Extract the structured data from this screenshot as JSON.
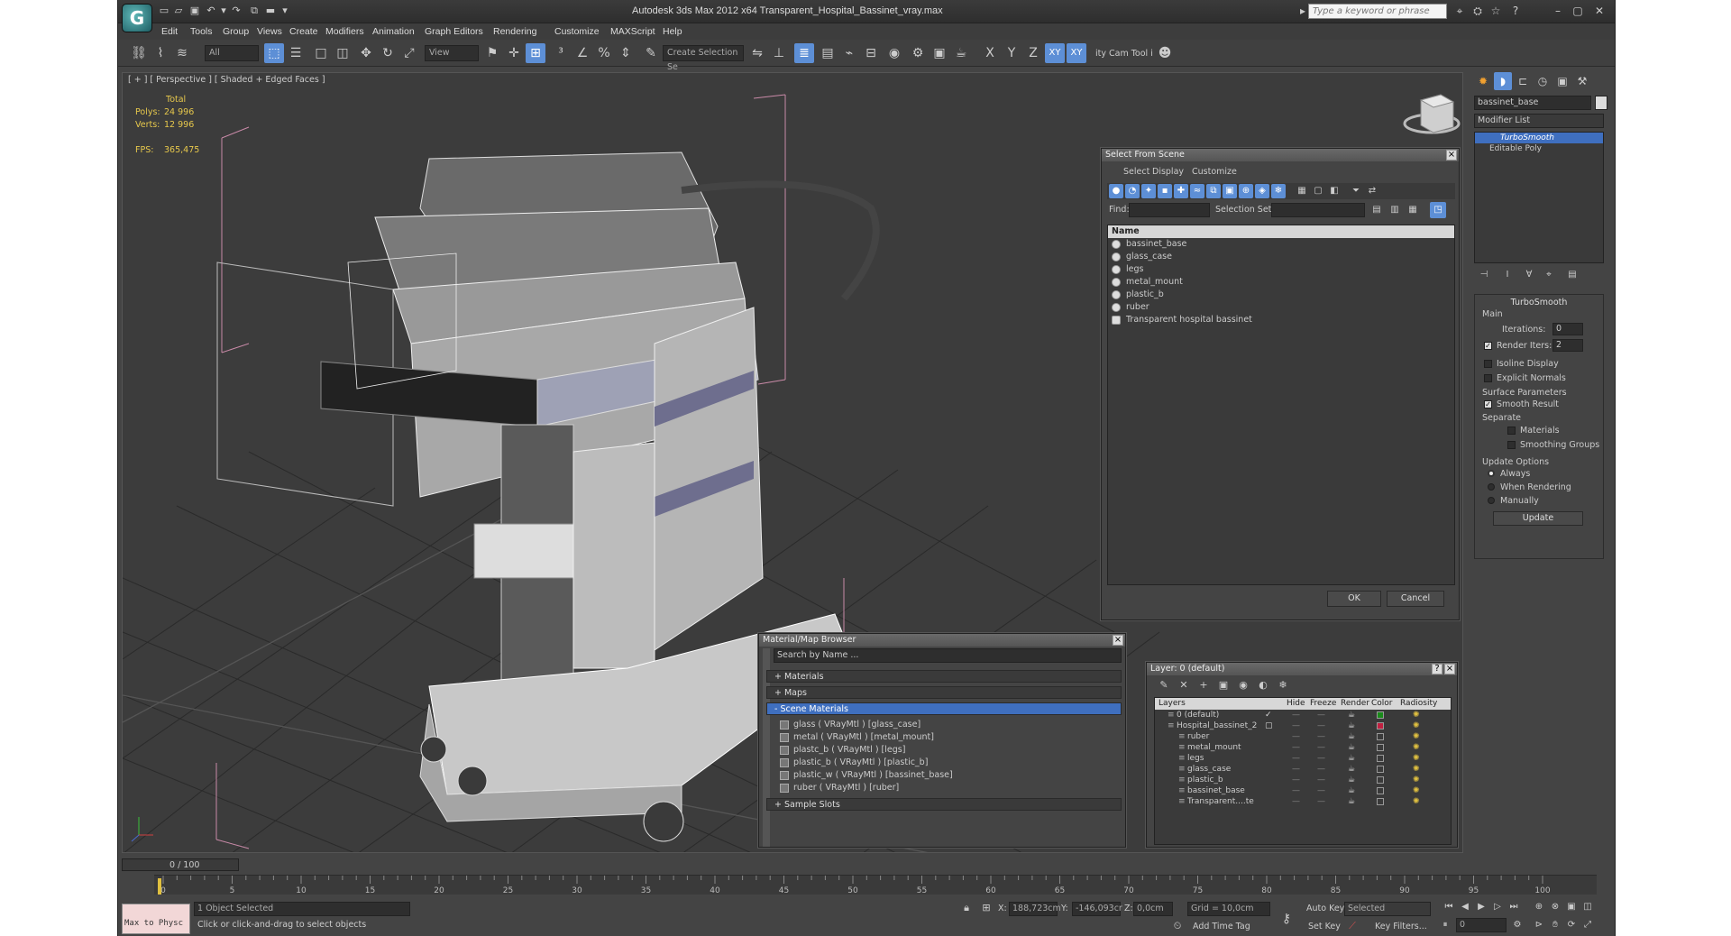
{
  "app": {
    "title": "Autodesk 3ds Max  2012 x64     Transparent_Hospital_Bassinet_vray.max",
    "search_placeholder": "Type a keyword or phrase",
    "logo_letter": "G"
  },
  "menu": [
    "Edit",
    "Tools",
    "Group",
    "Views",
    "Create",
    "Modifiers",
    "Animation",
    "Graph Editors",
    "Rendering",
    "Customize",
    "MAXScript",
    "Help"
  ],
  "toolbar": {
    "filter": "All",
    "ref_coord": "View",
    "selection_set": "Create Selection Se",
    "axes": [
      "X",
      "Y",
      "Z",
      "XY",
      "XY"
    ],
    "cam_tool": "ity Cam Tool i"
  },
  "viewport": {
    "label": "[ + ] [ Perspective ] [ Shaded + Edged Faces ]",
    "stats_total": "Total",
    "polys_label": "Polys:",
    "polys_value": "24 996",
    "verts_label": "Verts:",
    "verts_value": "12 996",
    "fps_label": "FPS:",
    "fps_value": "365,475"
  },
  "command_panel": {
    "object_name": "bassinet_base",
    "modifier_list": "Modifier List",
    "stack": [
      "TurboSmooth",
      "Editable Poly"
    ],
    "turbosmooth": {
      "title": "TurboSmooth",
      "main_label": "Main",
      "iterations_label": "Iterations:",
      "iterations_value": "0",
      "render_iters_label": "Render Iters:",
      "render_iters_value": "2",
      "isoline": "Isoline Display",
      "explicit": "Explicit Normals",
      "surface_params": "Surface Parameters",
      "smooth_result": "Smooth Result",
      "separate": "Separate",
      "materials": "Materials",
      "smoothing_groups": "Smoothing Groups",
      "update_options": "Update Options",
      "always": "Always",
      "when_rendering": "When Rendering",
      "manually": "Manually",
      "update_btn": "Update"
    }
  },
  "select_from_scene": {
    "title": "Select From Scene",
    "menu": [
      "Select",
      "Display",
      "Customize"
    ],
    "find_label": "Find:",
    "selection_set_label": "Selection Set:",
    "column_name": "Name",
    "items": [
      "bassinet_base",
      "glass_case",
      "legs",
      "metal_mount",
      "plastic_b",
      "ruber",
      "Transparent hospital bassinet"
    ],
    "ok": "OK",
    "cancel": "Cancel"
  },
  "material_browser": {
    "title": "Material/Map Browser",
    "search": "Search by Name ...",
    "sections": [
      "+ Materials",
      "+ Maps",
      "- Scene Materials",
      "+ Sample Slots"
    ],
    "scene_materials": [
      "glass  ( VRayMtl ) [glass_case]",
      "metal  ( VRayMtl ) [metal_mount]",
      "plastc_b  ( VRayMtl ) [legs]",
      "plastic_b  ( VRayMtl ) [plastic_b]",
      "plastic_w  ( VRayMtl ) [bassinet_base]",
      "ruber  ( VRayMtl ) [ruber]"
    ]
  },
  "layer_dialog": {
    "title": "Layer: 0 (default)",
    "help": "?",
    "columns": [
      "Layers",
      "Hide",
      "Freeze",
      "Render",
      "Color",
      "Radiosity"
    ],
    "rows": [
      {
        "name": "0 (default)",
        "indent": 1,
        "color": "#1a8a1a",
        "check": "✓"
      },
      {
        "name": "Hospital_bassinet_2",
        "indent": 1,
        "color": "#c02040",
        "check": "▢"
      },
      {
        "name": "ruber",
        "indent": 2,
        "color": "",
        "check": ""
      },
      {
        "name": "metal_mount",
        "indent": 2,
        "color": "",
        "check": ""
      },
      {
        "name": "legs",
        "indent": 2,
        "color": "",
        "check": ""
      },
      {
        "name": "glass_case",
        "indent": 2,
        "color": "",
        "check": ""
      },
      {
        "name": "plastic_b",
        "indent": 2,
        "color": "",
        "check": ""
      },
      {
        "name": "bassinet_base",
        "indent": 2,
        "color": "",
        "check": ""
      },
      {
        "name": "Transparent....te",
        "indent": 2,
        "color": "",
        "check": ""
      }
    ]
  },
  "timeline": {
    "frame": "0 / 100",
    "ticks": [
      "0",
      "5",
      "10",
      "15",
      "20",
      "25",
      "30",
      "35",
      "40",
      "45",
      "50",
      "55",
      "60",
      "65",
      "70",
      "75",
      "80",
      "85",
      "90",
      "95",
      "100"
    ]
  },
  "status": {
    "maxscript": "Max to Physc",
    "selected": "1 Object Selected",
    "prompt": "Click or click-and-drag to select objects",
    "x_label": "X:",
    "x_value": "188,723cm",
    "y_label": "Y:",
    "y_value": "-146,093cr",
    "z_label": "Z:",
    "z_value": "0,0cm",
    "grid": "Grid = 10,0cm",
    "add_time_tag": "Add Time Tag",
    "auto_key": "Auto Key",
    "set_key": "Set Key",
    "key_mode": "Selected",
    "key_filters": "Key Filters...",
    "frame_field": "0"
  }
}
